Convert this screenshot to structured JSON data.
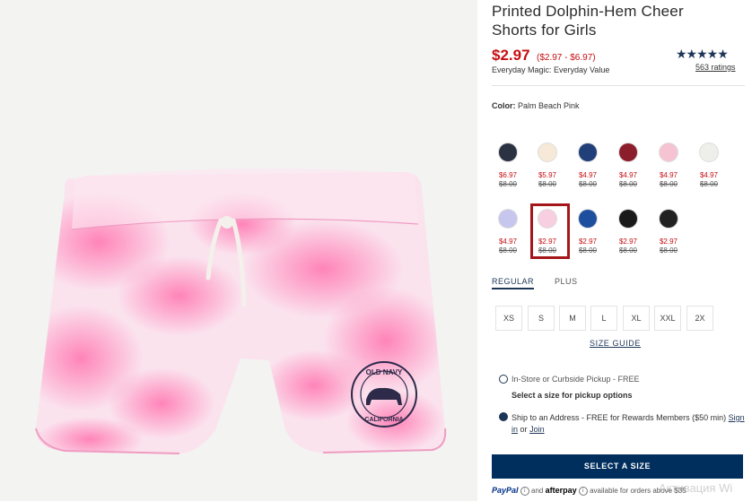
{
  "product": {
    "title_line1": "Printed Dolphin-Hem Cheer",
    "title_line2": "Shorts for Girls",
    "price": "$2.97",
    "price_range": "($2.97 - $6.97)",
    "tagline": "Everyday Magic: Everyday Value",
    "stars": "★★★★★",
    "ratings": "563 ratings",
    "print_text_top": "OLD NAVY",
    "print_text_bottom": "CALIFORNIA"
  },
  "color": {
    "label": "Color:",
    "value": "Palm Beach Pink"
  },
  "swatches": [
    {
      "icon": "navy-stripe-swatch",
      "color": "#2b3242",
      "price": "$6.97",
      "original": "$8.00"
    },
    {
      "icon": "multi-stripe-swatch",
      "color": "#f6e9d8",
      "price": "$5.97",
      "original": "$8.00"
    },
    {
      "icon": "navy-star-swatch",
      "color": "#21407a",
      "price": "$4.97",
      "original": "$8.00"
    },
    {
      "icon": "red-print-swatch",
      "color": "#8c1d2b",
      "price": "$4.97",
      "original": "$8.00"
    },
    {
      "icon": "pink-solid-swatch",
      "color": "#f5c3d2",
      "price": "$4.97",
      "original": "$8.00"
    },
    {
      "icon": "white-print-swatch",
      "color": "#eeeeea",
      "price": "$4.97",
      "original": "$8.00"
    },
    {
      "icon": "lavender-swatch",
      "color": "#c6c6ef",
      "price": "$4.97",
      "original": "$8.00"
    },
    {
      "icon": "palm-beach-pink-swatch",
      "color": "#f8cfe0",
      "price": "$2.97",
      "original": "$8.00"
    },
    {
      "icon": "blue-star-swatch",
      "color": "#1e4f9e",
      "price": "$2.97",
      "original": "$8.00"
    },
    {
      "icon": "black-dot-swatch",
      "color": "#1a1a1a",
      "price": "$2.97",
      "original": "$8.00"
    },
    {
      "icon": "black-print-swatch",
      "color": "#222222",
      "price": "$2.97",
      "original": "$8.00"
    }
  ],
  "fit_tabs": {
    "regular": "REGULAR",
    "plus": "PLUS"
  },
  "sizes": [
    "XS",
    "S",
    "M",
    "L",
    "XL",
    "XXL",
    "2X"
  ],
  "size_guide": "SIZE GUIDE",
  "fulfillment": {
    "pickup": "In-Store or Curbside Pickup - FREE",
    "pickup_hint": "Select a size for pickup options",
    "ship": "Ship to an Address - FREE for Rewards Members ($50 min)",
    "sign_in": "Sign in",
    "or": "or",
    "join": "Join"
  },
  "cta": "SELECT A SIZE",
  "payments": {
    "paypal": "PayPal",
    "and": "and",
    "afterpay": "afterpay",
    "note": "available for orders above $35"
  },
  "watermark": "Активация Wi",
  "colors": {
    "accent": "#c50e12",
    "brand": "#002e5d",
    "selected": "#a4161a"
  }
}
